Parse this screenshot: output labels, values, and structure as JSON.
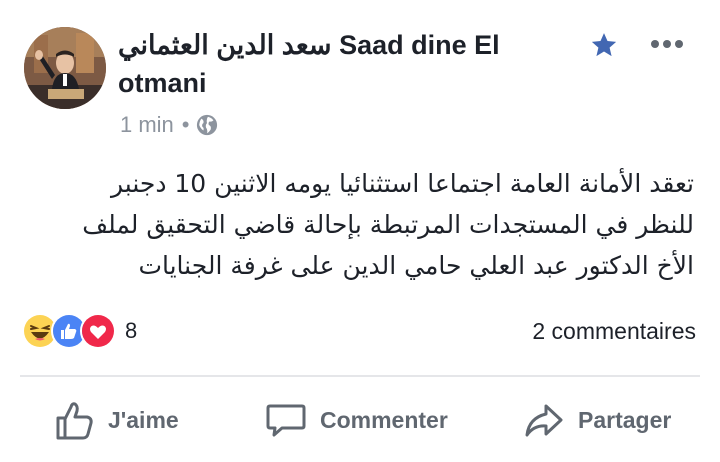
{
  "post": {
    "author_line1": "سعد الدين العثماني Saad dine El",
    "author_line2": "otmani",
    "timestamp": "1 min",
    "separator": "•",
    "privacy_icon": "globe-icon",
    "text_lines": [
      "تعقد الأمانة العامة اجتماعا استثنائيا يومه الاثنين 10 دجنبر",
      "للنظر في المستجدات المرتبطة بإحالة قاضي التحقيق لملف",
      "الأخ الدكتور عبد العلي حامي الدين على غرفة الجنايات"
    ]
  },
  "reactions": {
    "types": [
      "haha",
      "like",
      "love"
    ],
    "count": "8"
  },
  "comments_label": "2 commentaires",
  "actions": {
    "like": "J'aime",
    "comment": "Commenter",
    "share": "Partager"
  },
  "colors": {
    "accent": "#4267b2",
    "muted": "#8d949e",
    "action": "#606770",
    "love": "#f0284a",
    "haha": "#fcd354"
  }
}
